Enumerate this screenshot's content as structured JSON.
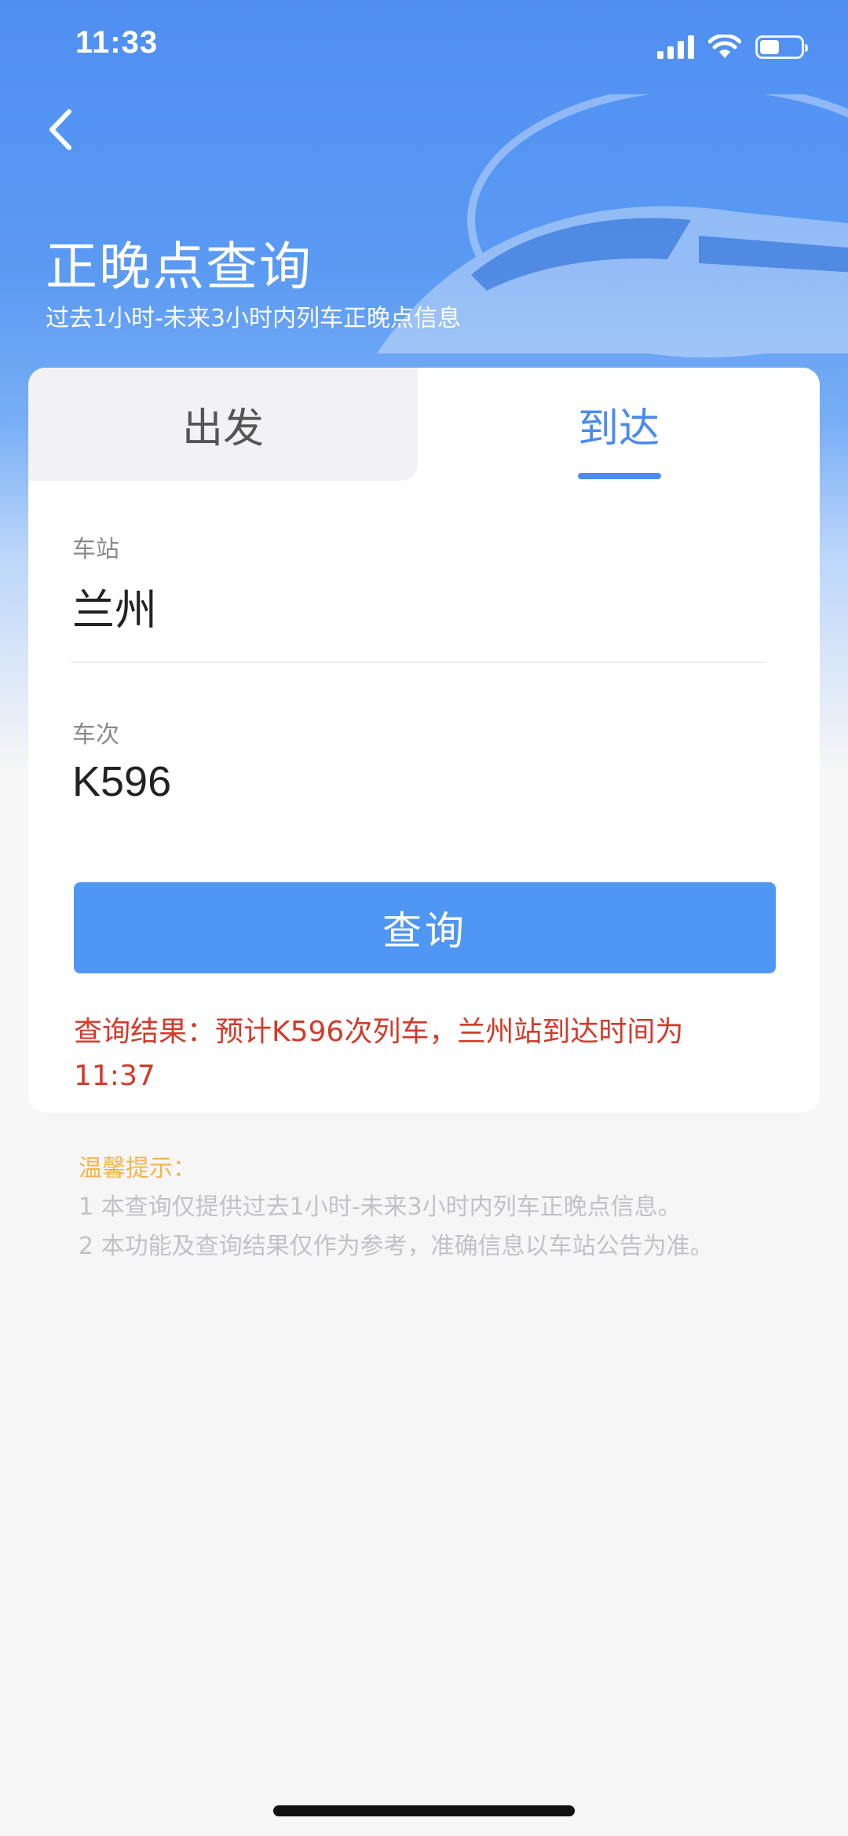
{
  "status_bar": {
    "time": "11:33"
  },
  "header": {
    "title": "正晚点查询",
    "subtitle": "过去1小时-未来3小时内列车正晚点信息"
  },
  "tabs": [
    {
      "label": "出发",
      "selected": false
    },
    {
      "label": "到达",
      "selected": true
    }
  ],
  "form": {
    "station_label": "车站",
    "station_value": "兰州",
    "train_label": "车次",
    "train_value": "K596"
  },
  "query_button": {
    "label": "查询"
  },
  "result": {
    "line1": "查询结果：预计K596次列车，兰州站到达时间为",
    "line2": "11:37"
  },
  "tips": {
    "title": "温馨提示：",
    "items": [
      "1 本查询仅提供过去1小时-未来3小时内列车正晚点信息。",
      "2 本功能及查询结果仅作为参考，准确信息以车站公告为准。"
    ]
  },
  "colors": {
    "accent": "#4b8bf0",
    "button": "#5096f3",
    "result_text": "#d23a2a",
    "tips_title": "#f3b54a"
  }
}
